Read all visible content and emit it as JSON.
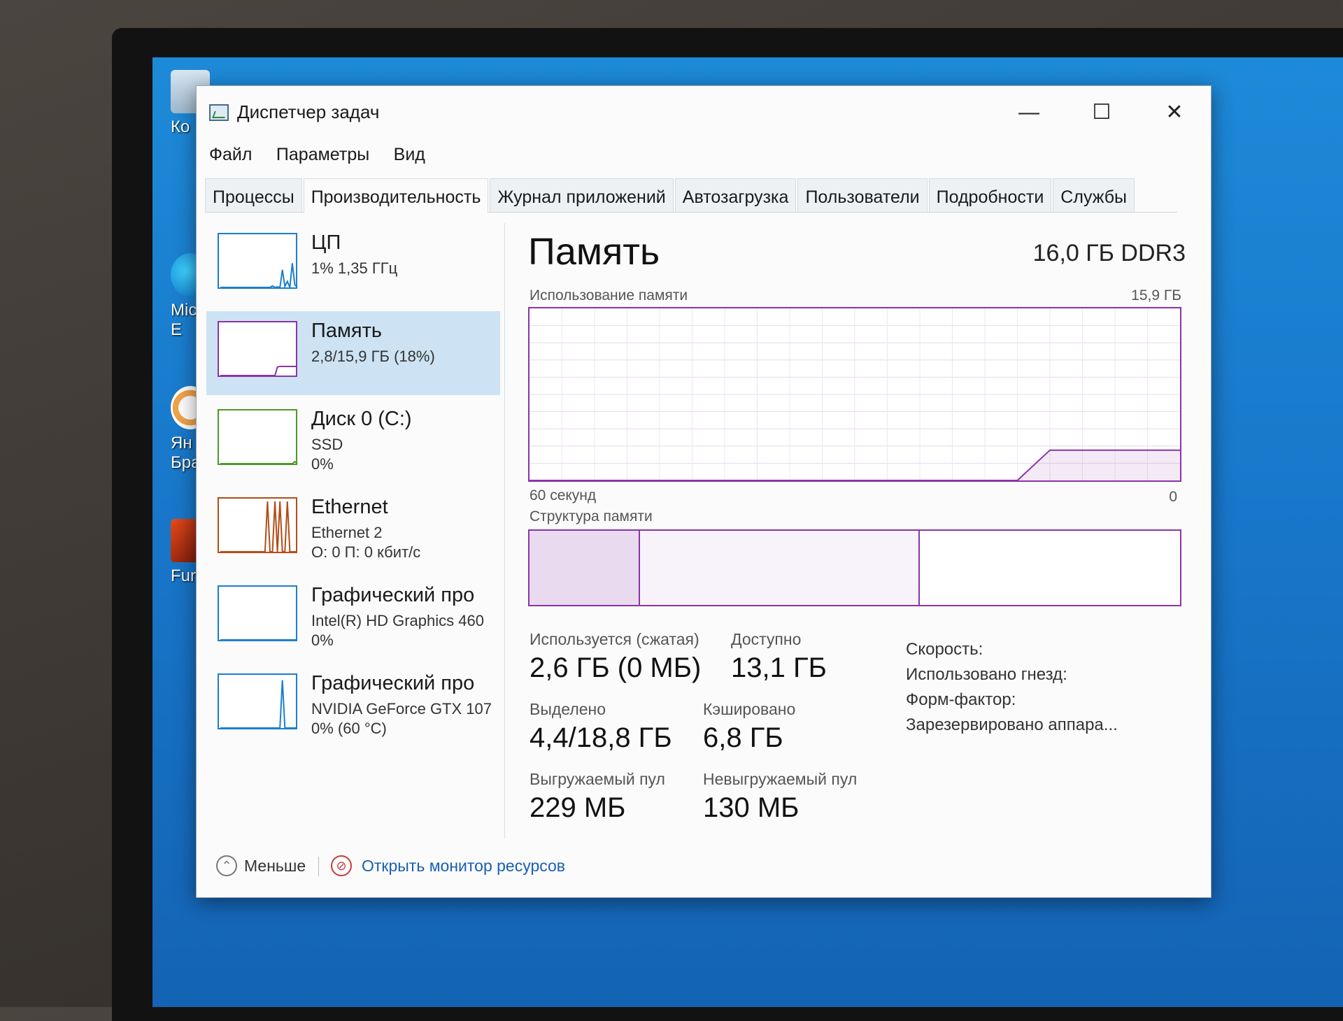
{
  "window": {
    "title": "Диспетчер задач",
    "controls": {
      "minimize": "—",
      "maximize": "☐",
      "close": "✕"
    }
  },
  "desktop": {
    "icons": [
      {
        "label": "Ко",
        "icon": "recycle-bin-icon"
      },
      {
        "label": "Mic",
        "label2": "E",
        "icon": "edge-icon"
      },
      {
        "label": "Ян",
        "label2": "Бра",
        "icon": "yandex-browser-icon"
      },
      {
        "label": "FurM",
        "icon": "furmark-icon"
      }
    ]
  },
  "menu": [
    "Файл",
    "Параметры",
    "Вид"
  ],
  "tabs": [
    {
      "label": "Процессы"
    },
    {
      "label": "Производительность",
      "active": true
    },
    {
      "label": "Журнал приложений"
    },
    {
      "label": "Автозагрузка"
    },
    {
      "label": "Пользователи"
    },
    {
      "label": "Подробности"
    },
    {
      "label": "Службы"
    }
  ],
  "nav": [
    {
      "name": "ЦП",
      "sub": "1% 1,35 ГГц",
      "sub2": "",
      "color": "#1b7fd0",
      "spark": [
        0,
        0,
        0,
        0,
        0,
        0,
        0,
        0,
        0,
        0,
        0,
        0,
        0,
        0,
        0,
        0,
        0,
        0,
        0,
        0,
        0,
        3,
        0,
        1,
        0,
        35,
        2,
        12,
        0,
        48,
        5,
        1
      ]
    },
    {
      "name": "Память",
      "sub": "2,8/15,9 ГБ (18%)",
      "sub2": "",
      "color": "#8b34a8",
      "selected": true,
      "spark": [
        0,
        0,
        0,
        0,
        0,
        0,
        0,
        0,
        0,
        0,
        0,
        0,
        0,
        0,
        0,
        0,
        0,
        0,
        0,
        0,
        0,
        0,
        0,
        17,
        18,
        18,
        18,
        18,
        18,
        18,
        18,
        18
      ]
    },
    {
      "name": "Диск 0 (C:)",
      "sub": "SSD",
      "sub2": "0%",
      "color": "#4d9a2a",
      "spark": [
        0,
        0,
        0,
        0,
        0,
        0,
        0,
        0,
        0,
        0,
        0,
        0,
        0,
        0,
        0,
        0,
        0,
        0,
        0,
        0,
        0,
        0,
        0,
        0,
        0,
        0,
        0,
        0,
        0,
        0,
        4,
        0
      ]
    },
    {
      "name": "Ethernet",
      "sub": "Ethernet 2",
      "sub2": "О: 0 П: 0 кбит/с",
      "color": "#b34d17",
      "spark": [
        0,
        0,
        0,
        0,
        0,
        0,
        0,
        0,
        0,
        0,
        0,
        0,
        0,
        0,
        0,
        0,
        0,
        0,
        0,
        100,
        0,
        0,
        100,
        0,
        100,
        0,
        0,
        100,
        0,
        0,
        0,
        0
      ]
    },
    {
      "name": "Графический про",
      "sub": "Intel(R) HD Graphics 460",
      "sub2": "0%",
      "color": "#1b7fd0",
      "spark": [
        0,
        0,
        0,
        0,
        0,
        0,
        0,
        0,
        0,
        0,
        0,
        0,
        0,
        0,
        0,
        0,
        0,
        0,
        0,
        0,
        0,
        0,
        0,
        0,
        0,
        0,
        0,
        0,
        0,
        0,
        0,
        0
      ]
    },
    {
      "name": "Графический про",
      "sub": "NVIDIA GeForce GTX 107",
      "sub2": "0% (60 °C)",
      "color": "#1b7fd0",
      "spark": [
        0,
        0,
        0,
        0,
        0,
        0,
        0,
        0,
        0,
        0,
        0,
        0,
        0,
        0,
        0,
        0,
        0,
        0,
        0,
        0,
        0,
        0,
        0,
        0,
        0,
        95,
        0,
        0,
        0,
        0,
        0,
        0
      ]
    }
  ],
  "panel": {
    "title": "Память",
    "spec": "16,0 ГБ DDR3",
    "usage_label": "Использование памяти",
    "usage_max": "15,9 ГБ",
    "time_label": "60 секунд",
    "time_zero": "0",
    "structure_label": "Структура памяти",
    "structure_fractions": {
      "in_use": 0.17,
      "modified": 0.0,
      "standby": 0.43,
      "free": 0.4
    },
    "stats": {
      "in_use_label": "Используется (сжатая)",
      "in_use_value": "2,6 ГБ (0 МБ)",
      "available_label": "Доступно",
      "available_value": "13,1 ГБ",
      "committed_label": "Выделено",
      "committed_value": "4,4/18,8 ГБ",
      "cached_label": "Кэшировано",
      "cached_value": "6,8 ГБ",
      "paged_label": "Выгружаемый пул",
      "paged_value": "229 МБ",
      "nonpaged_label": "Невыгружаемый пул",
      "nonpaged_value": "130 МБ"
    },
    "spec_labels": {
      "speed": "Скорость:",
      "slots": "Использовано гнезд:",
      "form_factor": "Форм-фактор:",
      "reserved": "Зарезервировано аппара..."
    }
  },
  "chart_data": {
    "type": "area",
    "title": "Использование памяти",
    "xlabel": "60 секунд",
    "ylabel": "",
    "ylim": [
      0,
      15.9
    ],
    "y_unit": "ГБ",
    "x": [
      -60,
      -57,
      -54,
      -51,
      -48,
      -45,
      -42,
      -39,
      -36,
      -33,
      -30,
      -27,
      -24,
      -21,
      -18,
      -15,
      -12,
      -9,
      -6,
      -3,
      0
    ],
    "values": [
      0,
      0,
      0,
      0,
      0,
      0,
      0,
      0,
      0,
      0,
      0,
      0,
      0,
      0,
      0,
      0,
      2.8,
      2.8,
      2.8,
      2.8,
      2.8
    ]
  },
  "footer": {
    "less": "Меньше",
    "resource_monitor": "Открыть монитор ресурсов"
  },
  "colors": {
    "memory": "#8b34a8",
    "selected": "#cde3f3",
    "link": "#1a5fb4"
  }
}
